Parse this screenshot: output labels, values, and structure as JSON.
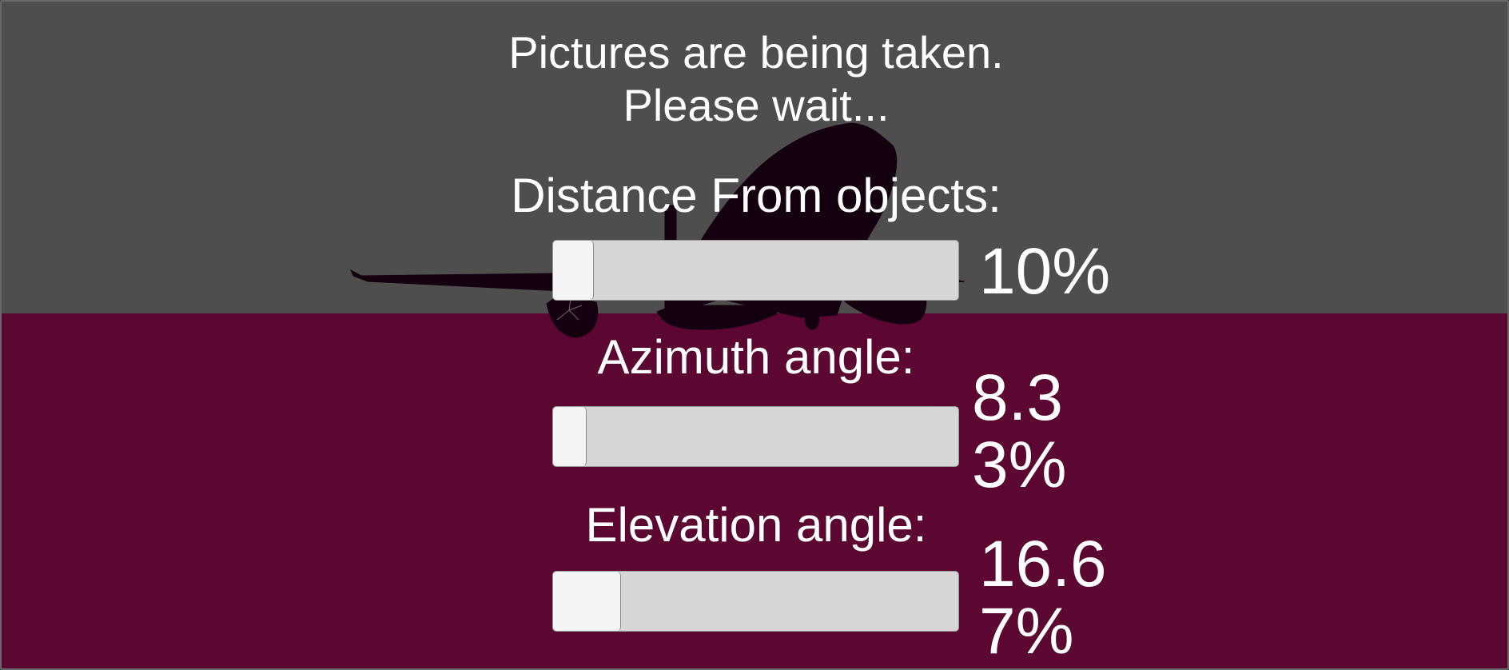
{
  "status": {
    "line1": "Pictures are being taken.",
    "line2": "Please wait..."
  },
  "sliders": [
    {
      "label": "Distance From objects:",
      "value_text": "10%",
      "level": 0.1
    },
    {
      "label": "Azimuth angle:",
      "value_text": "8.33%",
      "level": 0.0833
    },
    {
      "label": "Elevation angle:",
      "value_text": "16.67%",
      "level": 0.1667
    }
  ],
  "colors": {
    "top_background": "#4e4e4e",
    "bottom_background": "#5b0732",
    "silhouette": "#150010",
    "slider_track": "#d6d6d6",
    "slider_fill": "#f4f4f4",
    "text": "#ffffff"
  },
  "scene": {
    "object_icon": "airplane-silhouette-icon"
  }
}
